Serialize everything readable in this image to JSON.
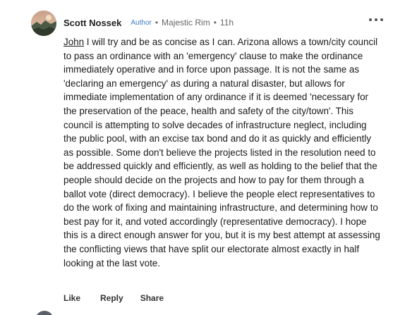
{
  "comment": {
    "author": "Scott Nossek",
    "badge": "Author",
    "separator": "•",
    "community": "Majestic Rim",
    "time": "11h",
    "mention": "John",
    "text": "  I will try and be as concise as I can.  Arizona allows a town/city council to pass an ordinance with an 'emergency' clause to make the ordinance immediately operative and in force upon passage.  It is not the same as 'declaring an emergency' as during a natural disaster, but allows for immediate implementation of any ordinance if it is deemed 'necessary for the preservation of the peace, health and safety of the city/town'.  This council is attempting to solve decades of infrastructure neglect, including the public pool, with an excise tax bond and do it as quickly and efficiently as possible.  Some don't believe the projects listed in the resolution need to be addressed quickly and efficiently, as well as holding to the belief that the people should decide on the projects and how to pay for them through a ballot vote (direct democracy).  I believe the people elect representatives to do the work of fixing and maintaining infrastructure, and determining how to best pay for it, and voted accordingly (representative democracy).  I hope this is a direct enough answer for you, but it is my best attempt at assessing the conflicting views that have split our electorate almost exactly in half looking at the last vote."
  },
  "actions": {
    "like": "Like",
    "reply": "Reply",
    "share": "Share"
  },
  "icons": {
    "more": "more-options-icon",
    "avatar": "user-avatar"
  }
}
